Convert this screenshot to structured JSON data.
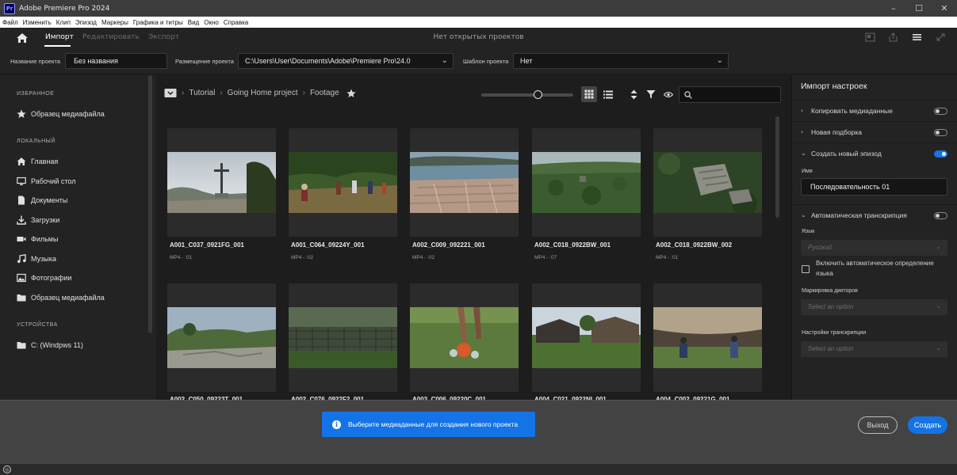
{
  "window": {
    "title": "Adobe Premiere Pro 2024",
    "logo": "Pr",
    "minimize": "–",
    "maximize": "☐",
    "close": "✕"
  },
  "menu": [
    "Файл",
    "Изменить",
    "Клип",
    "Эпизод",
    "Маркеры",
    "Графика и титры",
    "Вид",
    "Окно",
    "Справка"
  ],
  "topbar": {
    "tabs": {
      "import": "Импорт",
      "edit": "Редактировать",
      "export": "Экспорт"
    },
    "center_title": "Нет открытых проектов"
  },
  "project": {
    "name_label": "Название проекта",
    "name_value": "Без названия",
    "location_label": "Размещение проекта",
    "location_value": "C:\\Users\\User\\Documents\\Adobe\\Premiere Pro\\24.0",
    "template_label": "Шаблон проекта",
    "template_value": "Нет"
  },
  "sidebar": {
    "favorites_header": "ИЗБРАННОЕ",
    "favorites": [
      {
        "label": "Образец медиафайла",
        "icon": "star-icon"
      }
    ],
    "local_header": "ЛОКАЛЬНЫЙ",
    "local": [
      {
        "label": "Главная",
        "icon": "home-icon"
      },
      {
        "label": "Рабочий стол",
        "icon": "desktop-icon"
      },
      {
        "label": "Документы",
        "icon": "document-icon"
      },
      {
        "label": "Загрузки",
        "icon": "download-icon"
      },
      {
        "label": "Фильмы",
        "icon": "video-camera-icon"
      },
      {
        "label": "Музыка",
        "icon": "music-icon"
      },
      {
        "label": "Фотографии",
        "icon": "photo-icon"
      },
      {
        "label": "Образец медиафайла",
        "icon": "folder-icon"
      }
    ],
    "devices_header": "УСТРОЙСТВА",
    "devices": [
      {
        "label": "C: (Windpws 11)",
        "icon": "folder-icon"
      }
    ]
  },
  "browser": {
    "breadcrumb": [
      "Tutorial",
      "Going Home project",
      "Footage"
    ],
    "breadcrumb_sep": "›",
    "clips": [
      {
        "name": "A001_C037_0921FG_001",
        "meta": "MP4 - :01",
        "scene": "cross"
      },
      {
        "name": "A001_C064_09224Y_001",
        "meta": "MP4 - :02",
        "scene": "soccer"
      },
      {
        "name": "A002_C009_092221_001",
        "meta": "MP4 - :02",
        "scene": "town"
      },
      {
        "name": "A002_C018_0922BW_001",
        "meta": "MP4 - :07",
        "scene": "jungle"
      },
      {
        "name": "A002_C018_0922BW_002",
        "meta": "MP4 - :01",
        "scene": "ruins"
      },
      {
        "name": "A002_C050_09223T_001",
        "meta": "",
        "scene": "cliff"
      },
      {
        "name": "A002_C076_0922F2_001",
        "meta": "",
        "scene": "fence"
      },
      {
        "name": "A003_C006_09220C_001",
        "meta": "",
        "scene": "ball"
      },
      {
        "name": "A004_C021_0922NI_001",
        "meta": "",
        "scene": "huts"
      },
      {
        "name": "A004_C002_09221G_001",
        "meta": "",
        "scene": "kids"
      }
    ]
  },
  "import_settings": {
    "title": "Импорт настроек",
    "copy_media": "Копировать медиаданные",
    "copy_media_on": false,
    "new_bin": "Новая подборка",
    "new_bin_on": false,
    "new_sequence": "Создать новый эпизод",
    "new_sequence_on": true,
    "name_label": "Имя",
    "sequence_name": "Последовательность 01",
    "auto_transcription": "Автоматическая транскрипция",
    "auto_transcription_on": false,
    "language_label": "Язык",
    "language_value": "Русский",
    "auto_detect_label": "Включить автоматическое определение языка",
    "speaker_label": "Маркировка дикторов",
    "speaker_placeholder": "Select an option",
    "transcription_settings_label": "Настройки транскрипции",
    "transcription_placeholder": "Select an option"
  },
  "footer": {
    "toast": "Выберите медиаданные для создания нового проекта",
    "exit": "Выход",
    "create": "Создать"
  },
  "colors": {
    "accent": "#1473e6",
    "panel": "#232323",
    "background": "#1d1d1d"
  }
}
